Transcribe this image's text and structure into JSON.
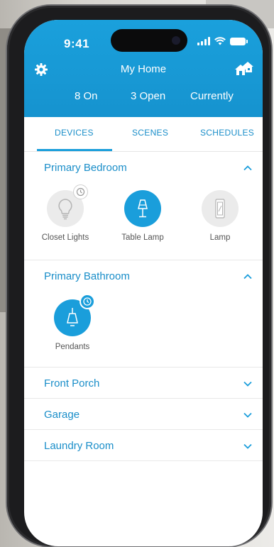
{
  "status_bar": {
    "time": "9:41"
  },
  "header": {
    "title": "My Home",
    "summary": [
      "8 On",
      "3 Open",
      "Currently"
    ]
  },
  "tabs": [
    {
      "label": "DEVICES",
      "active": true
    },
    {
      "label": "SCENES",
      "active": false
    },
    {
      "label": "SCHEDULES",
      "active": false
    }
  ],
  "rooms": [
    {
      "name": "Primary Bedroom",
      "expanded": true,
      "devices": [
        {
          "label": "Closet Lights",
          "state": "off",
          "icon": "bulb-icon",
          "timer": true
        },
        {
          "label": "Table Lamp",
          "state": "on",
          "icon": "table-lamp-icon",
          "timer": false
        },
        {
          "label": "Lamp",
          "state": "off",
          "icon": "switch-icon",
          "timer": false
        }
      ]
    },
    {
      "name": "Primary Bathroom",
      "expanded": true,
      "devices": [
        {
          "label": "Pendants",
          "state": "on",
          "icon": "pendant-light-icon",
          "timer": true
        }
      ]
    },
    {
      "name": "Front Porch",
      "expanded": false
    },
    {
      "name": "Garage",
      "expanded": false
    },
    {
      "name": "Laundry Room",
      "expanded": false
    }
  ],
  "colors": {
    "accent": "#1a9edb",
    "header": "#1693cf",
    "device_off": "#ebebeb"
  }
}
